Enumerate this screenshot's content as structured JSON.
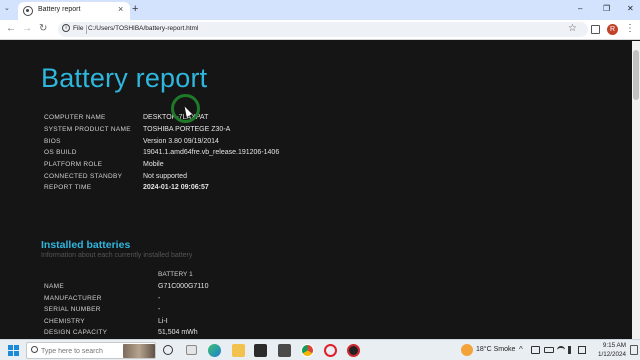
{
  "browser": {
    "tab_title": "Battery report",
    "tab_close": "×",
    "new_tab": "+",
    "tab_list": "⌄",
    "window_controls": {
      "minimize": "–",
      "maximize": "❐",
      "close": "✕"
    },
    "nav": {
      "back": "←",
      "forward": "→",
      "reload": "↻"
    },
    "address": {
      "chip": "File",
      "url": "C:/Users/TOSHIBA/battery-report.html"
    },
    "profile_initial": "R",
    "star": "☆",
    "menu": "⋮"
  },
  "report": {
    "title": "Battery report",
    "info": [
      {
        "label": "COMPUTER NAME",
        "value": "DESKTOP-7LAXPAT"
      },
      {
        "label": "SYSTEM PRODUCT NAME",
        "value": "TOSHIBA PORTEGE Z30-A"
      },
      {
        "label": "BIOS",
        "value": "Version 3.80 09/19/2014"
      },
      {
        "label": "OS BUILD",
        "value": "19041.1.amd64fre.vb_release.191206-1406"
      },
      {
        "label": "PLATFORM ROLE",
        "value": "Mobile"
      },
      {
        "label": "CONNECTED STANDBY",
        "value": "Not supported"
      },
      {
        "label": "REPORT TIME",
        "value": "2024-01-12  09:06:57"
      }
    ],
    "installed": {
      "heading": "Installed batteries",
      "subheading": "Information about each currently installed battery",
      "column": "BATTERY 1",
      "rows": [
        {
          "label": "NAME",
          "value": "G71C000G7110"
        },
        {
          "label": "MANUFACTURER",
          "value": "-"
        },
        {
          "label": "SERIAL NUMBER",
          "value": "-"
        },
        {
          "label": "CHEMISTRY",
          "value": "Li-I"
        },
        {
          "label": "DESIGN CAPACITY",
          "value": "51,504 mWh"
        }
      ]
    }
  },
  "taskbar": {
    "search_placeholder": "Type here to search",
    "weather": "18°C  Smoke",
    "tray_chevron": "^",
    "time": "9:15 AM",
    "date": "1/12/2024",
    "icons": [
      "task-view-icon",
      "edge-icon",
      "file-explorer-icon",
      "store-icon",
      "mail-icon",
      "chrome-icon",
      "opera-icon",
      "opera-gx-icon"
    ]
  },
  "colors": {
    "accent": "#2fb6dd",
    "page_bg": "#151515",
    "tabstrip": "#d3e3fd",
    "cursor_ring": "#1e7a28"
  }
}
